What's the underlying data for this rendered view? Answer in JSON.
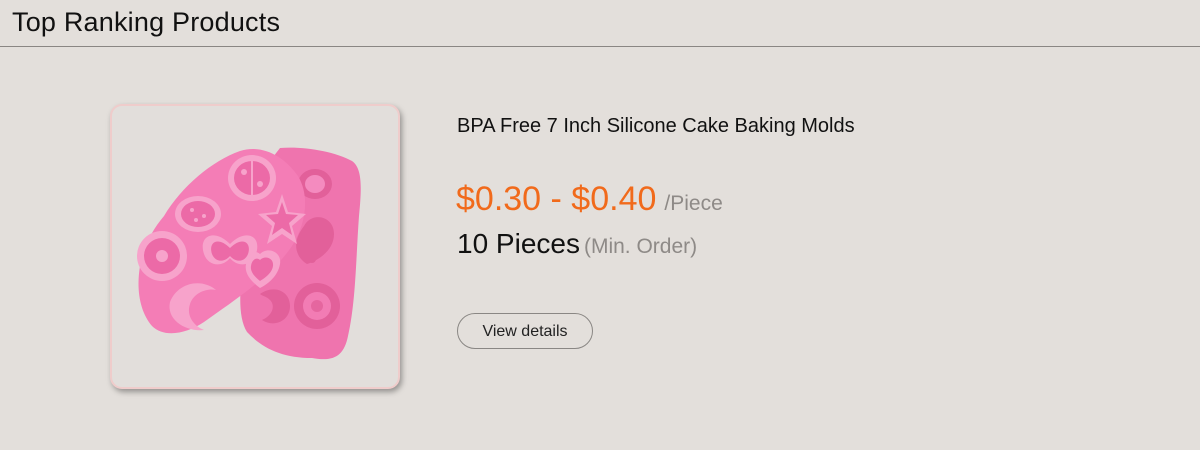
{
  "header": {
    "title": "Top Ranking Products"
  },
  "product": {
    "image_icon": "silicone-cake-mold-image",
    "title": "BPA Free 7 Inch Silicone Cake Baking Molds",
    "price_range": "$0.30 - $0.40",
    "price_unit": "/Piece",
    "moq_quantity": "10 Pieces",
    "moq_label": "(Min. Order)",
    "view_details_label": "View details"
  },
  "colors": {
    "background": "#e3dfdb",
    "price_accent": "#f16a1b",
    "muted_text": "#8e8a87",
    "mold_pink": "#f277b2",
    "frame_border": "#efcccb"
  }
}
